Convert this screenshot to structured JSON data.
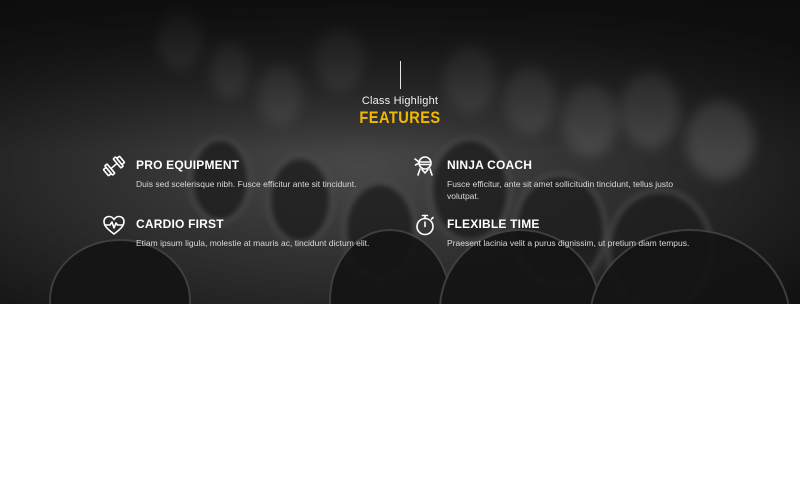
{
  "section": {
    "subtitle": "Class Highlight",
    "title": "FEATURES",
    "title_color": "#f5b800"
  },
  "features": [
    {
      "icon": "dumbbell-icon",
      "title": "PRO EQUIPMENT",
      "description": "Duis sed scelerisque nibh. Fusce efficitur ante sit tincidunt."
    },
    {
      "icon": "ninja-icon",
      "title": "NINJA COACH",
      "description": "Fusce efficitur, ante sit amet sollicitudin tincidunt, tellus justo volutpat."
    },
    {
      "icon": "heartbeat-icon",
      "title": "CARDIO FIRST",
      "description": "Etiam ipsum ligula, molestie at mauris ac, tincidunt dictum elit."
    },
    {
      "icon": "stopwatch-icon",
      "title": "FLEXIBLE TIME",
      "description": "Praesent lacinia velit a purus dignissim, ut pretium diam tempus."
    }
  ]
}
